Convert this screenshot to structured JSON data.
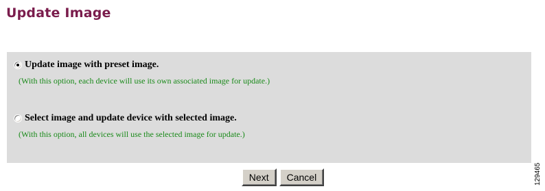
{
  "page": {
    "title": "Update Image"
  },
  "options": [
    {
      "label": "Update image with preset image.",
      "description": "(With this option, each device will use its own associated image for update.)",
      "selected": true
    },
    {
      "label": "Select image and update device with selected image.",
      "description": "(With this option, all devices will use the selected image for update.)",
      "selected": false
    }
  ],
  "buttons": {
    "next_label": "Next",
    "cancel_label": "Cancel"
  },
  "figure_id": "129465",
  "colors": {
    "title": "#7a1c4c",
    "panel_background": "#dcdcdc",
    "description_text": "#1a8a1a",
    "button_face": "#d4d0c8"
  }
}
